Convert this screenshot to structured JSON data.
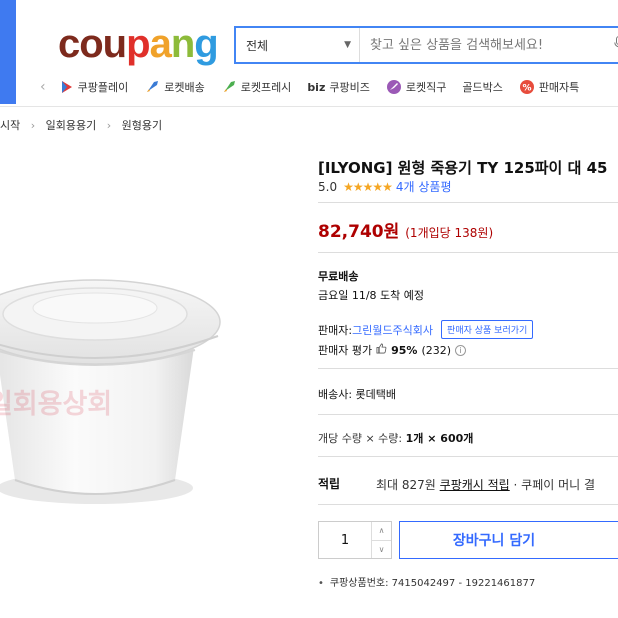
{
  "header": {
    "logo_parts": [
      "cou",
      "p",
      "a",
      "n",
      "g"
    ],
    "search": {
      "category": "전체",
      "placeholder": "찾고 싶은 상품을 검색해보세요!"
    }
  },
  "nav": {
    "items": [
      {
        "label": "쿠팡플레이",
        "icon": "play-icon",
        "color": "#e03a3a"
      },
      {
        "label": "로켓배송",
        "icon": "rocket-icon",
        "color": "#3a7bd5"
      },
      {
        "label": "로켓프레시",
        "icon": "rocket-fresh-icon",
        "color": "#4caf50"
      },
      {
        "label": "쿠팡비즈",
        "icon": "biz-icon",
        "prefix": "biz"
      },
      {
        "label": "로켓직구",
        "icon": "globe-icon",
        "color": "#9b59b6"
      },
      {
        "label": "골드박스",
        "icon": "none"
      },
      {
        "label": "판매자특",
        "icon": "percent-icon",
        "color": "#e74c3c"
      }
    ]
  },
  "breadcrumb": [
    "시작",
    "일회용용기",
    "원형용기"
  ],
  "product": {
    "title": "[ILYONG] 원형 죽용기 TY 125파이 대 45",
    "rating_value": "5.0",
    "stars": "★★★★★",
    "review_count": "4개 상품평",
    "price": "82,740원",
    "unit_price": "(1개입당 138원)",
    "watermark": "일회용상회",
    "shipping": {
      "label": "무료배송",
      "arrival": "금요일 11/8 도착 예정"
    },
    "seller": {
      "label": "판매자:",
      "name": "그린월드주식회사",
      "button": "판매자 상품 보러가기",
      "rating_label": "판매자 평가",
      "rating_pct": "95%",
      "rating_count": "(232)"
    },
    "carrier": "배송사: 롯데택배",
    "quantity_info_label": "개당 수량 × 수량:",
    "quantity_info_value": "1개 × 600개",
    "reward": {
      "label": "적립",
      "prefix": "최대 827원 ",
      "link": "쿠팡캐시 적립",
      "suffix": " · 쿠페이 머니 결"
    },
    "quantity": "1",
    "cart_button": "장바구니 담기",
    "product_number": "쿠팡상품번호: 7415042497 - 19221461877"
  },
  "colors": {
    "accent_blue": "#346aff",
    "price_red": "#ae0000",
    "search_border": "#4285f4",
    "star": "#f5a623"
  }
}
